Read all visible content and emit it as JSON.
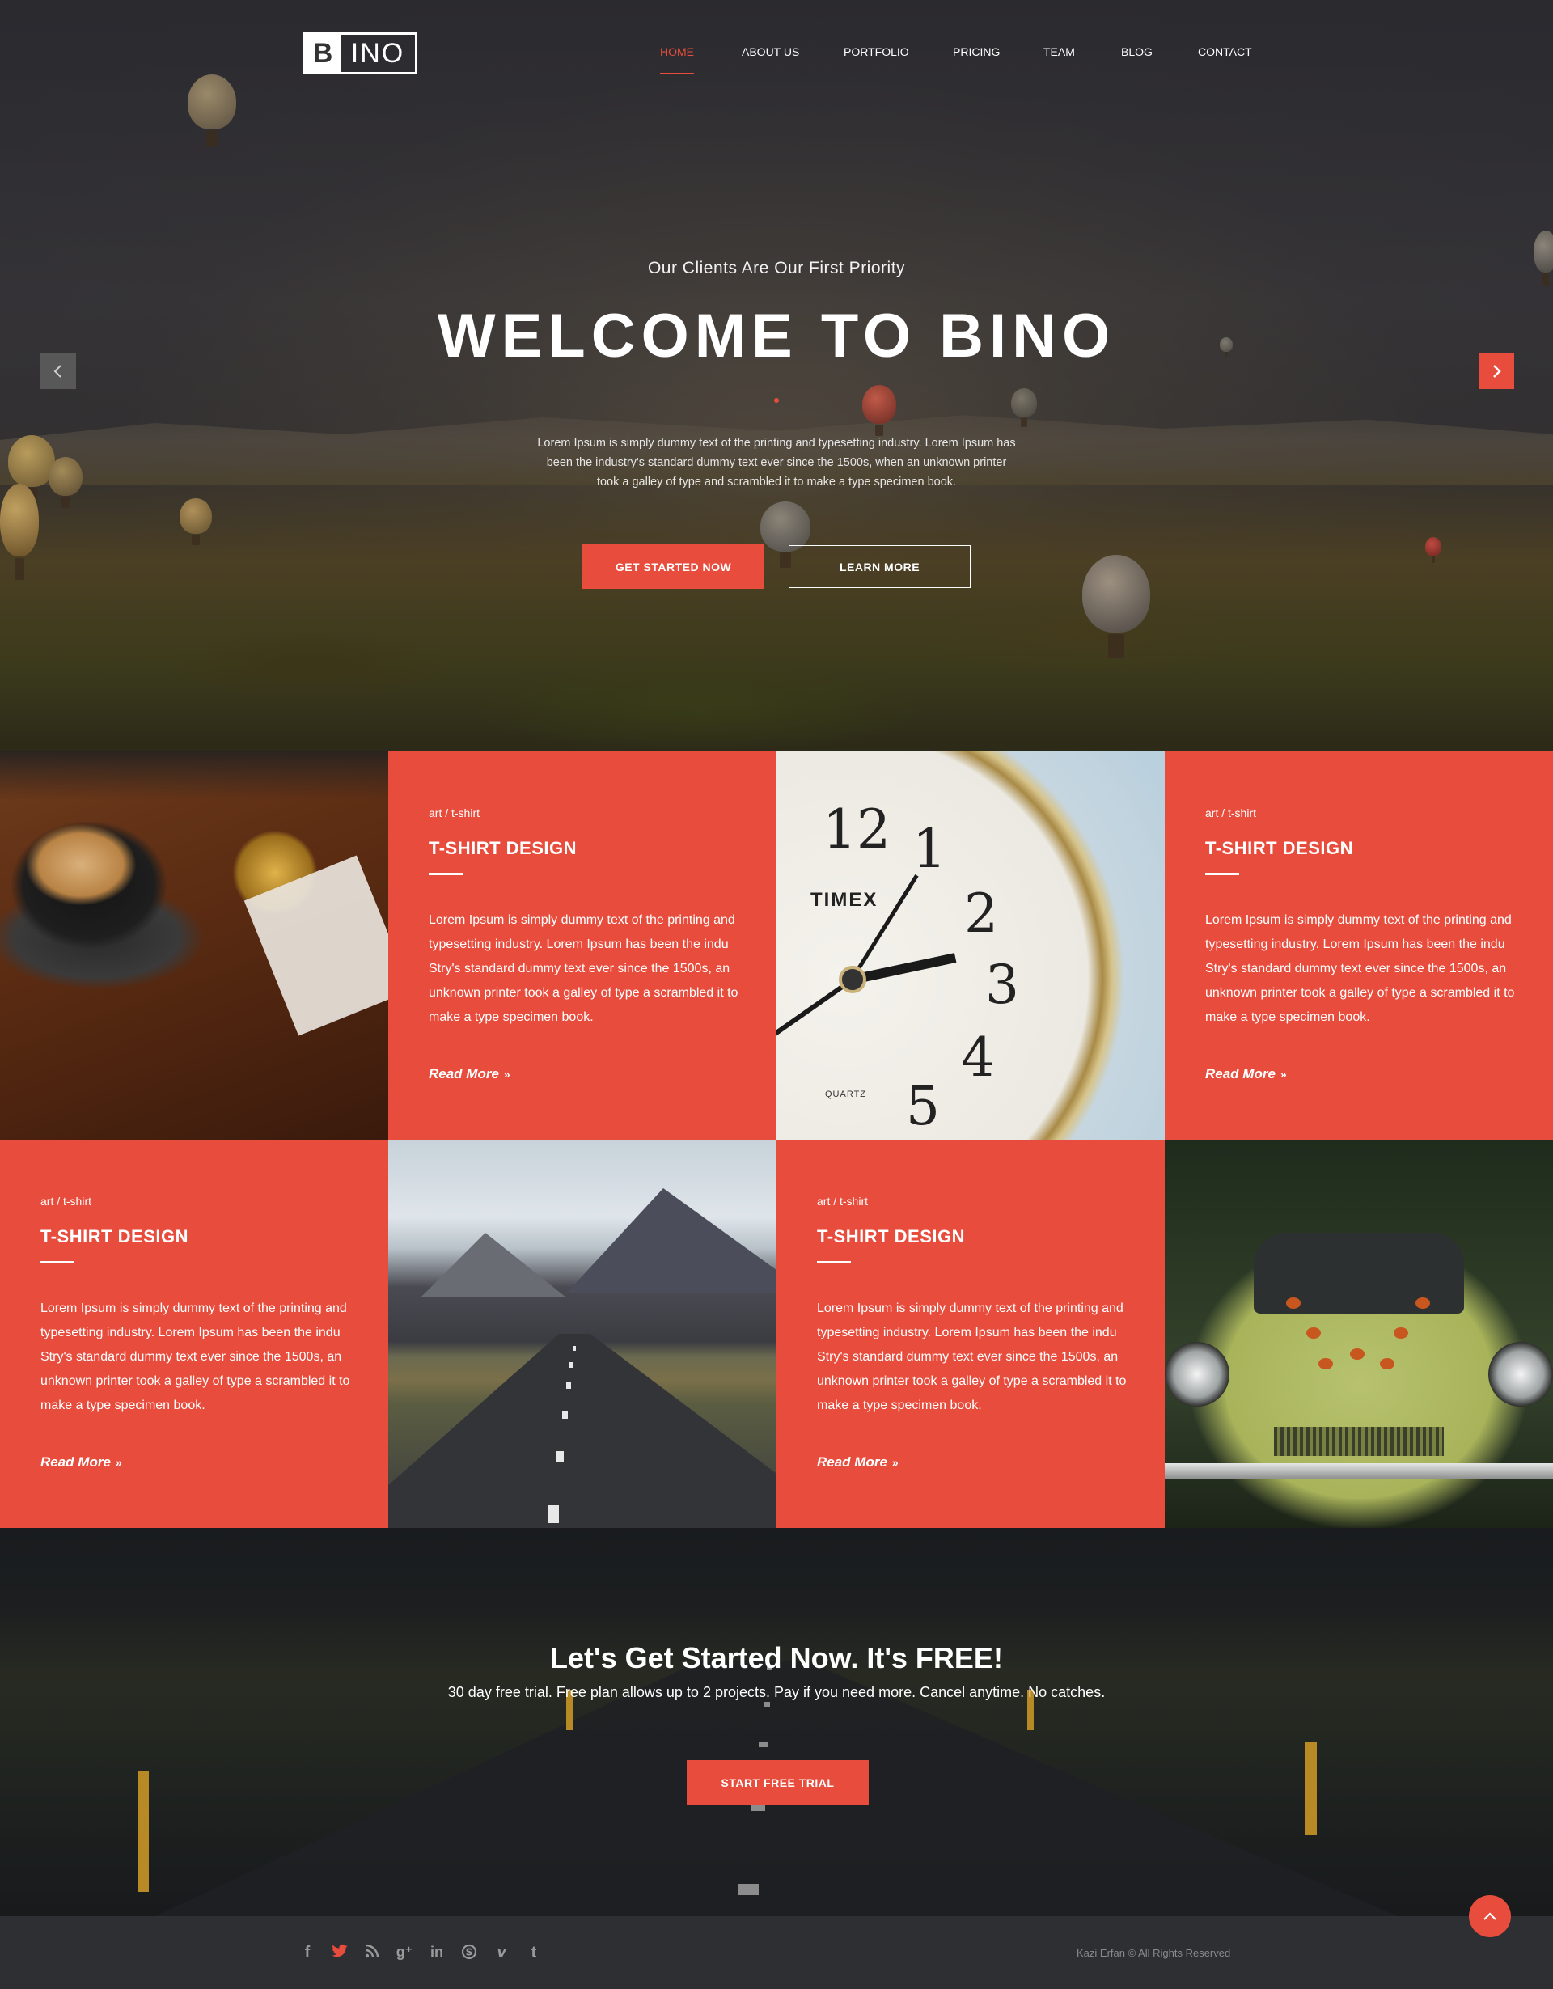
{
  "logo": {
    "letter": "B",
    "rest": "INO"
  },
  "nav": {
    "items": [
      "HOME",
      "ABOUT US",
      "PORTFOLIO",
      "PRICING",
      "TEAM",
      "BLOG",
      "CONTACT"
    ],
    "active": "HOME"
  },
  "hero": {
    "subtitle": "Our Clients Are Our First Priority",
    "title": "WELCOME TO BINO",
    "text": "Lorem Ipsum is simply dummy text of the printing and typesetting industry. Lorem Ipsum has been the industry's standard dummy text ever since the 1500s, when an unknown printer took a galley of type and scrambled it to make a type specimen book.",
    "primary_button": "GET STARTED NOW",
    "secondary_button": "LEARN MORE",
    "prev_icon": "chevron-left-icon",
    "next_icon": "chevron-right-icon"
  },
  "cards": [
    {
      "category": "art / t-shirt",
      "title": "T-SHIRT DESIGN",
      "text": "Lorem Ipsum is simply dummy text of the printing and typesetting industry. Lorem Ipsum has been the indu Stry's standard dummy text ever since the 1500s, an unknown printer took a galley of type a scrambled it to make a type specimen book.",
      "link": "Read More"
    },
    {
      "category": "art / t-shirt",
      "title": "T-SHIRT DESIGN",
      "text": "Lorem Ipsum is simply dummy text of the printing and typesetting industry. Lorem Ipsum has been the indu Stry's standard dummy text ever since the 1500s, an unknown printer took a galley of type a scrambled it to make a type specimen book.",
      "link": "Read More"
    },
    {
      "category": "art / t-shirt",
      "title": "T-SHIRT DESIGN",
      "text": "Lorem Ipsum is simply dummy text of the printing and typesetting industry. Lorem Ipsum has been the indu Stry's standard dummy text ever since the 1500s, an unknown printer took a galley of type a scrambled it to make a type specimen book.",
      "link": "Read More"
    },
    {
      "category": "art / t-shirt",
      "title": "T-SHIRT DESIGN",
      "text": "Lorem Ipsum is simply dummy text of the printing and typesetting industry. Lorem Ipsum has been the indu Stry's standard dummy text ever since the 1500s, an unknown printer took a galley of type a scrambled it to make a type specimen book.",
      "link": "Read More"
    }
  ],
  "images": {
    "clock_brand": "TIMEX",
    "clock_quartz": "QUARTZ",
    "clock_numerals": [
      "12",
      "1",
      "2",
      "3",
      "4",
      "5"
    ]
  },
  "cta": {
    "title_light": "Let's Get Started Now.",
    "title_bold": "It's FREE!",
    "text": "30 day free trial. Free plan allows up to 2 projects. Pay if you need more. Cancel anytime. No catches.",
    "button": "START FREE TRIAL"
  },
  "footer": {
    "social": [
      "facebook-icon",
      "twitter-icon",
      "rss-icon",
      "google-plus-icon",
      "linkedin-icon",
      "skype-icon",
      "vimeo-icon",
      "tumblr-icon"
    ],
    "copyright": "Kazi Erfan © All Rights Reserved",
    "to_top_icon": "chevron-up-icon"
  },
  "colors": {
    "accent": "#e74c3c",
    "footer": "#2d2f33"
  }
}
